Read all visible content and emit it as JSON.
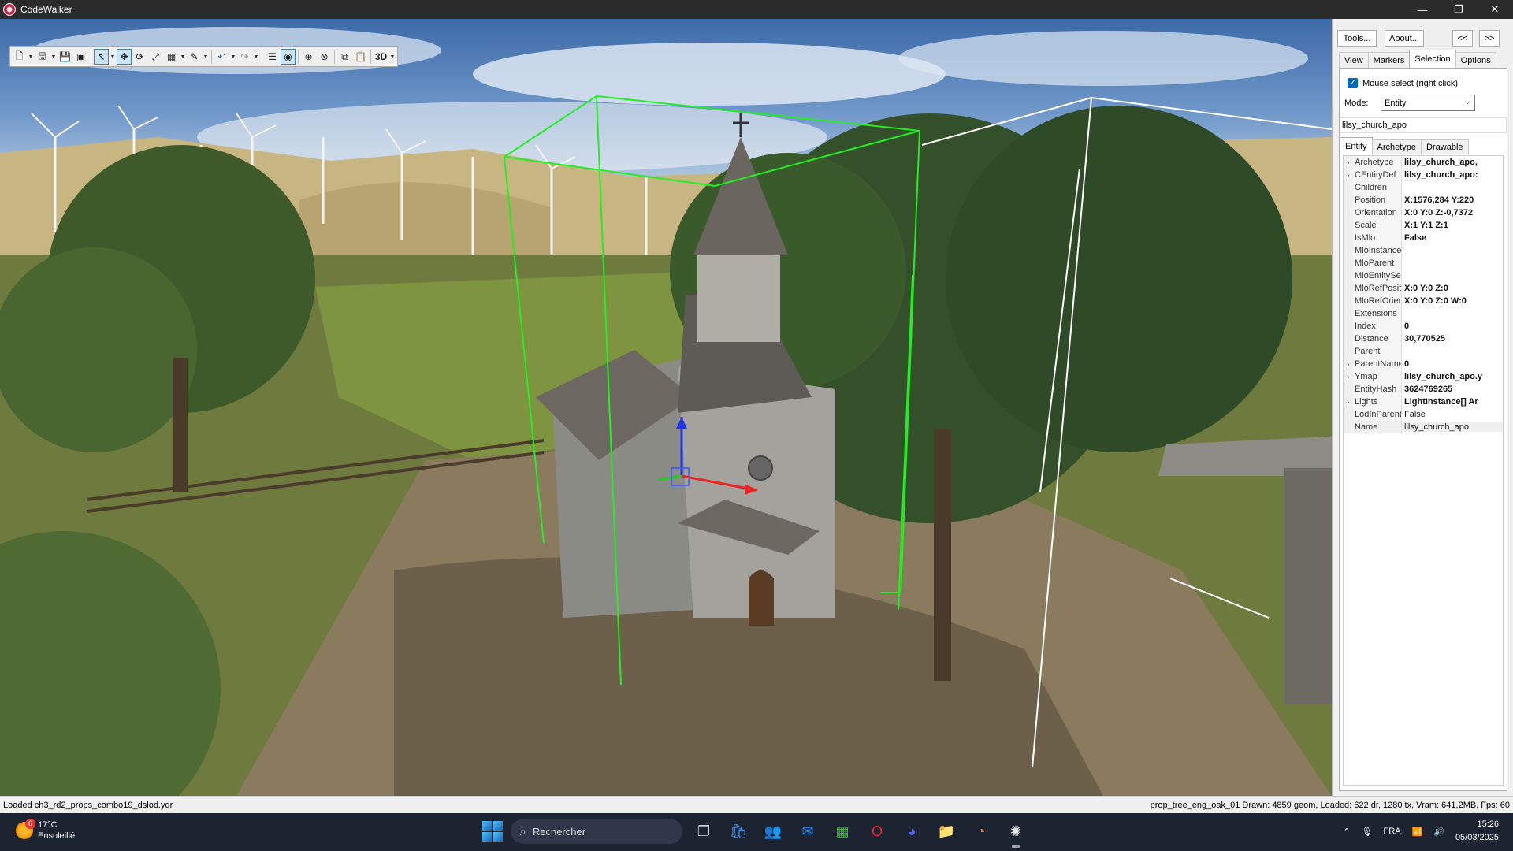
{
  "window": {
    "title": "CodeWalker",
    "controls": [
      "—",
      "❐",
      "✕"
    ]
  },
  "toolbar": {
    "view_mode": "3D"
  },
  "panel": {
    "tools_button": "Tools...",
    "about_button": "About...",
    "collapse_button": "<<",
    "expand_button": ">>",
    "tabs": [
      "View",
      "Markers",
      "Selection",
      "Options"
    ],
    "active_tab": "Selection",
    "mouse_select_label": "Mouse select (right click)",
    "mode_label": "Mode:",
    "mode_value": "Entity",
    "selected_name": "lilsy_church_apo",
    "subtabs": [
      "Entity",
      "Archetype",
      "Drawable"
    ],
    "properties": [
      {
        "name": "Archetype",
        "value": "lilsy_church_apo,",
        "expandable": true,
        "bold": true
      },
      {
        "name": "CEntityDef",
        "value": "lilsy_church_apo:",
        "expandable": true,
        "bold": true
      },
      {
        "name": "Children",
        "value": "",
        "expandable": false,
        "bold": true
      },
      {
        "name": "Position",
        "value": "X:1576,284 Y:220",
        "expandable": false,
        "bold": true
      },
      {
        "name": "Orientation",
        "value": "X:0 Y:0 Z:-0,7372",
        "expandable": false,
        "bold": true
      },
      {
        "name": "Scale",
        "value": "X:1 Y:1 Z:1",
        "expandable": false,
        "bold": true
      },
      {
        "name": "IsMlo",
        "value": "False",
        "expandable": false,
        "bold": true
      },
      {
        "name": "MloInstance",
        "value": "",
        "expandable": false,
        "bold": true
      },
      {
        "name": "MloParent",
        "value": "",
        "expandable": false,
        "bold": true
      },
      {
        "name": "MloEntitySet",
        "value": "",
        "expandable": false,
        "bold": true
      },
      {
        "name": "MloRefPositic",
        "value": "X:0 Y:0 Z:0",
        "expandable": false,
        "bold": true
      },
      {
        "name": "MloRefOrient:",
        "value": "X:0 Y:0 Z:0 W:0",
        "expandable": false,
        "bold": true
      },
      {
        "name": "Extensions",
        "value": "",
        "expandable": false,
        "bold": true
      },
      {
        "name": "Index",
        "value": "0",
        "expandable": false,
        "bold": true
      },
      {
        "name": "Distance",
        "value": "30,770525",
        "expandable": false,
        "bold": true
      },
      {
        "name": "Parent",
        "value": "",
        "expandable": false,
        "bold": true
      },
      {
        "name": "ParentName",
        "value": "0",
        "expandable": true,
        "bold": true
      },
      {
        "name": "Ymap",
        "value": "lilsy_church_apo.y",
        "expandable": true,
        "bold": true
      },
      {
        "name": "EntityHash",
        "value": "3624769265",
        "expandable": false,
        "bold": true
      },
      {
        "name": "Lights",
        "value": "LightInstance[] Ar",
        "expandable": true,
        "bold": true
      },
      {
        "name": "LodInParentY",
        "value": "False",
        "expandable": false,
        "bold": false
      },
      {
        "name": "Name",
        "value": "lilsy_church_apo",
        "expandable": false,
        "bold": false,
        "selected": true
      }
    ]
  },
  "status": {
    "left": "Loaded ch3_rd2_props_combo19_dslod.ydr",
    "right": "prop_tree_eng_oak_01  Drawn: 4859 geom, Loaded: 622 dr, 1280 tx, Vram: 641,2MB, Fps: 60"
  },
  "taskbar": {
    "weather_temp": "17°C",
    "weather_desc": "Ensoleillé",
    "weather_badge": "6",
    "search_placeholder": "Rechercher",
    "language": "FRA",
    "time": "15:26",
    "date": "05/03/2025"
  },
  "colors": {
    "selection_box": "#22ee22",
    "secondary_box": "#ffffff",
    "gizmo_x": "#ee2222",
    "gizmo_y": "#22cc22",
    "gizmo_z": "#2233ee",
    "checkbox_accent": "#0067c0"
  }
}
